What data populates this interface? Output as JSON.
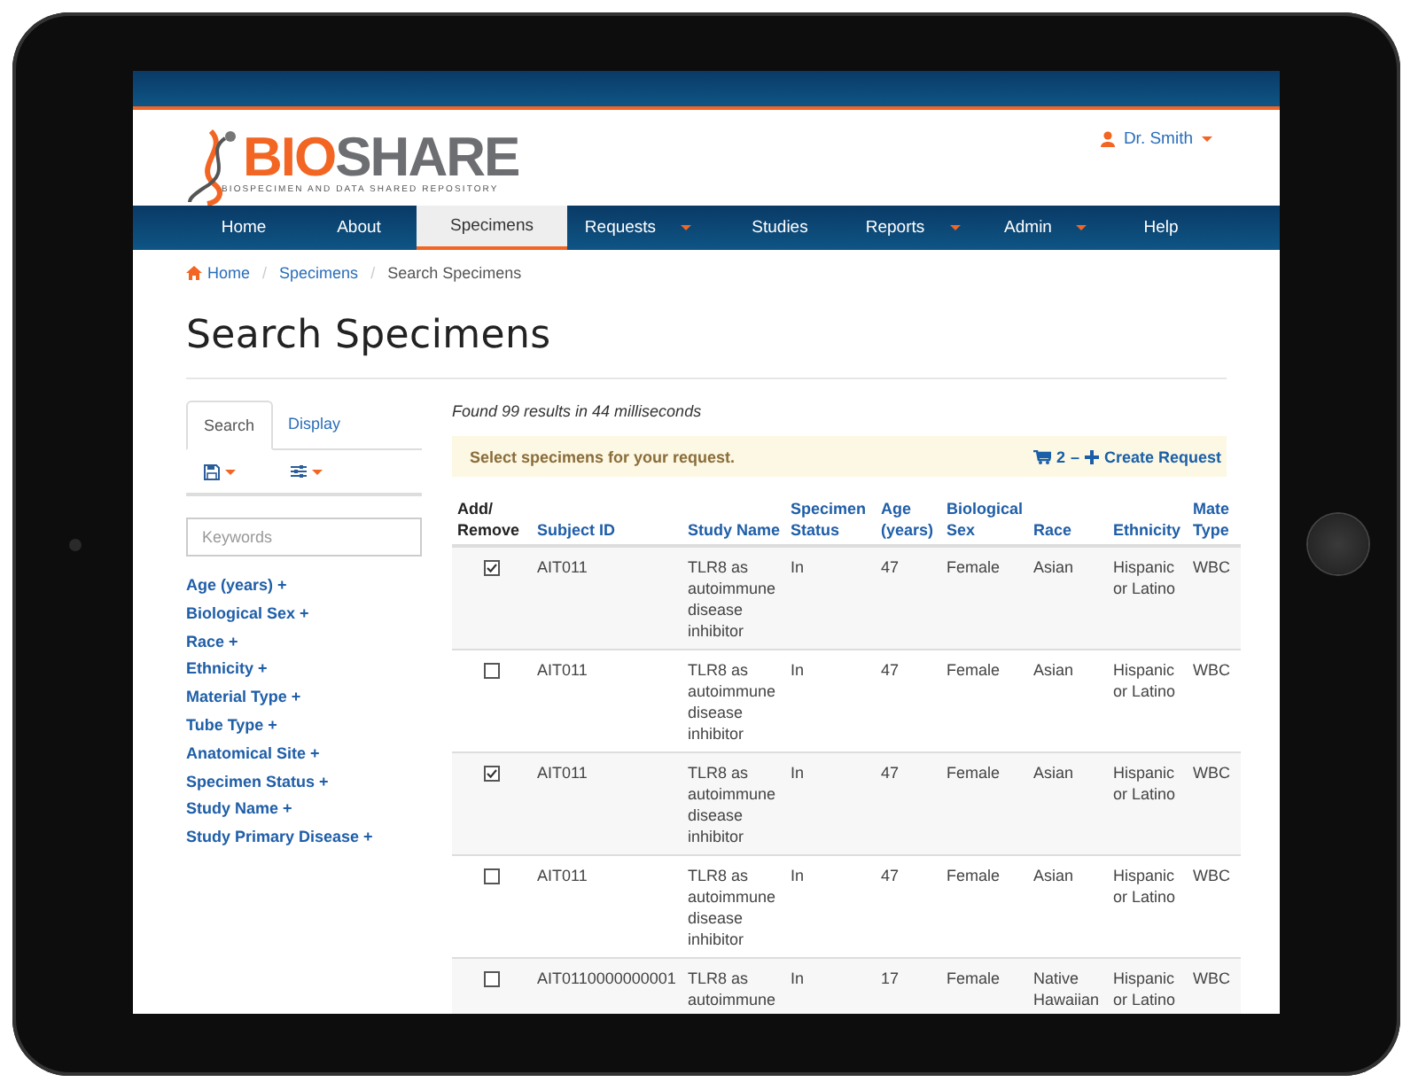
{
  "header": {
    "logo": {
      "part_1": "BIO",
      "part_2": "SHARE",
      "tagline": "BIOSPECIMEN AND DATA SHARED REPOSITORY"
    },
    "user_menu": "Dr. Smith"
  },
  "nav": [
    {
      "label": "Home",
      "selected": false,
      "has_menu": false
    },
    {
      "label": "About",
      "selected": false,
      "has_menu": false
    },
    {
      "label": "Specimens",
      "selected": true,
      "has_menu": false
    },
    {
      "label": "Requests",
      "selected": false,
      "has_menu": true
    },
    {
      "label": "Studies",
      "selected": false,
      "has_menu": false
    },
    {
      "label": "Reports",
      "selected": false,
      "has_menu": true
    },
    {
      "label": "Admin",
      "selected": false,
      "has_menu": true
    },
    {
      "label": "Help",
      "selected": false,
      "has_menu": false
    }
  ],
  "breadcrumb": [
    {
      "label": "Home",
      "kind": "home"
    },
    {
      "separator_before": "/",
      "label": "Specimens",
      "kind": "link"
    },
    {
      "separator_before": "/",
      "label": "Search Specimens",
      "kind": "current"
    }
  ],
  "page_title": "Search Specimens",
  "sidebar": {
    "tabs": [
      {
        "label": "Search",
        "selected": true
      },
      {
        "label": "Display",
        "selected": false
      }
    ],
    "keywords_placeholder": "Keywords",
    "filters": [
      "Age (years) +",
      "Biological Sex +",
      "Race +",
      "Ethnicity +",
      "Material Type +",
      "Tube Type +",
      "Anatomical Site +",
      "Specimen Status +",
      "Study Name +",
      "Study Primary Disease +"
    ]
  },
  "results": {
    "summary": "Found 99 results in 44 milliseconds",
    "alert": "Select specimens for your request.",
    "cart_count": "2",
    "separator": "–",
    "create_request": "Create Request"
  },
  "table": {
    "columns": [
      {
        "label": "Add/ Remove",
        "kind": "plain"
      },
      {
        "label": "Subject ID",
        "kind": "sortable"
      },
      {
        "label": "Study Name",
        "kind": "sortable"
      },
      {
        "label": "Specimen Status",
        "kind": "sortable"
      },
      {
        "label": "Age (years)",
        "kind": "sortable"
      },
      {
        "label": "Biological Sex",
        "kind": "sortable"
      },
      {
        "label": "Race",
        "kind": "sortable"
      },
      {
        "label": "Ethnicity",
        "kind": "sortable"
      },
      {
        "label": "Mate Type",
        "kind": "sortable"
      }
    ],
    "rows": [
      {
        "checked": true,
        "cells": [
          "",
          "AIT011",
          "TLR8 as autoimmune disease inhibitor",
          "In",
          "47",
          "Female",
          "Asian",
          "Hispanic or Latino",
          "WBC"
        ]
      },
      {
        "checked": false,
        "cells": [
          "",
          "AIT011",
          "TLR8 as autoimmune disease inhibitor",
          "In",
          "47",
          "Female",
          "Asian",
          "Hispanic or Latino",
          "WBC"
        ]
      },
      {
        "checked": true,
        "cells": [
          "",
          "AIT011",
          "TLR8 as autoimmune disease inhibitor",
          "In",
          "47",
          "Female",
          "Asian",
          "Hispanic or Latino",
          "WBC"
        ]
      },
      {
        "checked": false,
        "cells": [
          "",
          "AIT011",
          "TLR8 as autoimmune disease inhibitor",
          "In",
          "47",
          "Female",
          "Asian",
          "Hispanic or Latino",
          "WBC"
        ]
      },
      {
        "checked": false,
        "cells": [
          "",
          "AIT0110000000001",
          "TLR8 as autoimmune",
          "In",
          "17",
          "Female",
          "Native Hawaiian",
          "Hispanic or Latino",
          "WBC"
        ]
      }
    ]
  }
}
